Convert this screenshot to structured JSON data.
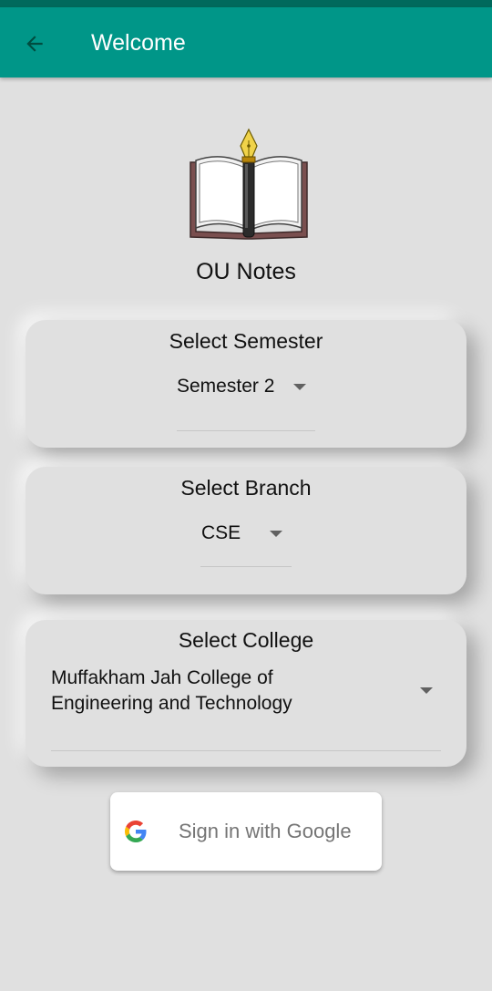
{
  "app_bar": {
    "title": "Welcome",
    "back_icon": "arrow-left-icon",
    "color": "#009688",
    "status_color": "#00695c"
  },
  "logo": {
    "icon": "book-with-pen-icon",
    "app_name": "OU Notes"
  },
  "semester": {
    "label": "Select Semester",
    "selected": "Semester 2"
  },
  "branch": {
    "label": "Select Branch",
    "selected": "CSE"
  },
  "college": {
    "label": "Select College",
    "selected": "Muffakham Jah College of Engineering and Technology"
  },
  "sign_in": {
    "label": "Sign in with Google",
    "icon": "google-icon"
  }
}
